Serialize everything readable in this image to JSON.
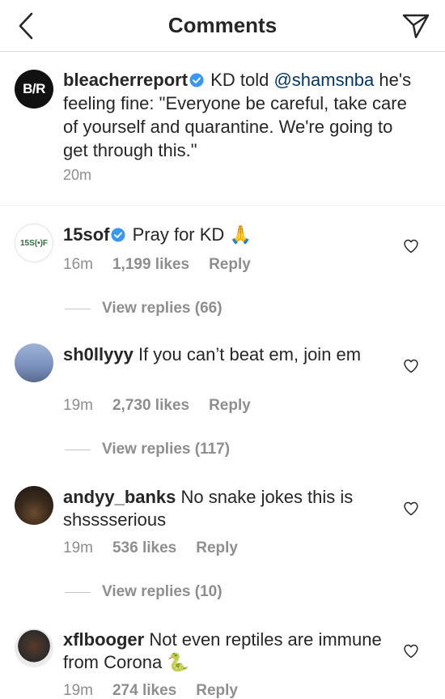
{
  "header": {
    "title": "Comments"
  },
  "caption": {
    "avatar_text": "B/R",
    "username": "bleacherreport",
    "text_before": " KD told ",
    "mention": "@shamsnba",
    "text_after": " he's feeling fine: \"Everyone be careful, take care of yourself and quarantine. We're going to get through this.\"",
    "time": "20m"
  },
  "comments": [
    {
      "avatar_text": "15S(•)F",
      "username": "15sof",
      "verified": true,
      "text": "Pray for KD",
      "emoji": "🙏",
      "time": "16m",
      "likes": "1,199 likes",
      "reply": "Reply",
      "view_replies": "View replies (66)"
    },
    {
      "username": "sh0llyyy",
      "verified": false,
      "text": "If you can’t beat em, join em",
      "time": "19m",
      "likes": "2,730 likes",
      "reply": "Reply",
      "view_replies": "View replies (117)"
    },
    {
      "username": "andyy_banks",
      "verified": false,
      "text": "No snake jokes this is shsssserious",
      "time": "19m",
      "likes": "536 likes",
      "reply": "Reply",
      "view_replies": "View replies (10)"
    },
    {
      "username": "xflbooger",
      "verified": false,
      "text": "Not even reptiles are immune from Corona",
      "emoji": "🐍",
      "time": "19m",
      "likes": "274 likes",
      "reply": "Reply"
    }
  ],
  "icons": {
    "back": "chevron-left-icon",
    "share": "paper-plane-icon",
    "verified": "verified-badge-icon",
    "heart": "heart-outline-icon"
  },
  "colors": {
    "verified": "#3897f0",
    "mention": "#00376b",
    "meta": "#8e8e8e"
  }
}
